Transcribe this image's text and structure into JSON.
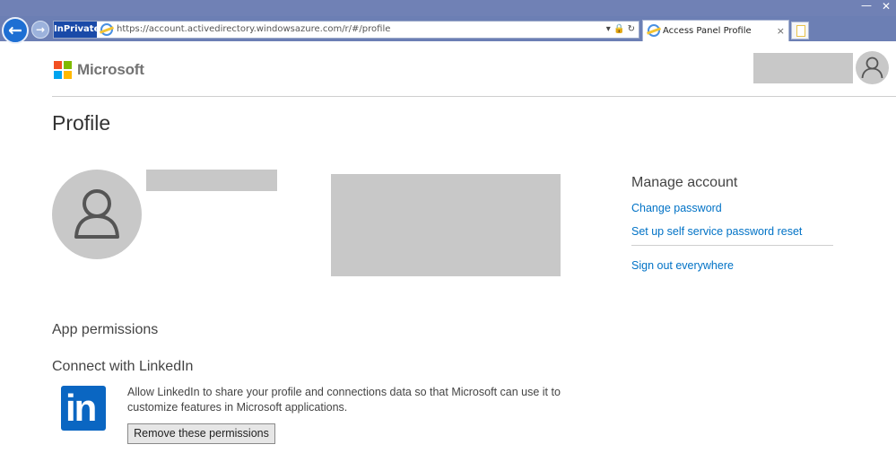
{
  "browser": {
    "inprivate_label": "InPrivate",
    "url": "https://account.activedirectory.windowsazure.com/r/#/profile",
    "address_tools": "▾ 🔒 ↻",
    "tab_title": "Access Panel Profile",
    "tab_close": "×",
    "minimize": "—",
    "close": "✕"
  },
  "header": {
    "brand": "Microsoft"
  },
  "page": {
    "title": "Profile"
  },
  "manage_account": {
    "title": "Manage account",
    "links": [
      "Change password",
      "Set up self service password reset",
      "Sign out everywhere"
    ]
  },
  "app_permissions": {
    "title": "App permissions",
    "linkedin": {
      "title": "Connect with LinkedIn",
      "logo_text": "in",
      "description": "Allow LinkedIn to share your profile and connections data so that Microsoft can use it to customize features in Microsoft applications.",
      "remove_button": "Remove these permissions"
    }
  },
  "icons": {
    "back": "back-arrow-icon",
    "forward": "forward-arrow-icon",
    "ie": "ie-icon",
    "lock": "lock-icon",
    "refresh": "refresh-icon",
    "user": "user-icon"
  },
  "colors": {
    "link": "#0072c6",
    "placeholder_gray": "#c8c8c8",
    "linkedin_blue": "#0a66c2",
    "chrome": "#6c7fb4"
  }
}
